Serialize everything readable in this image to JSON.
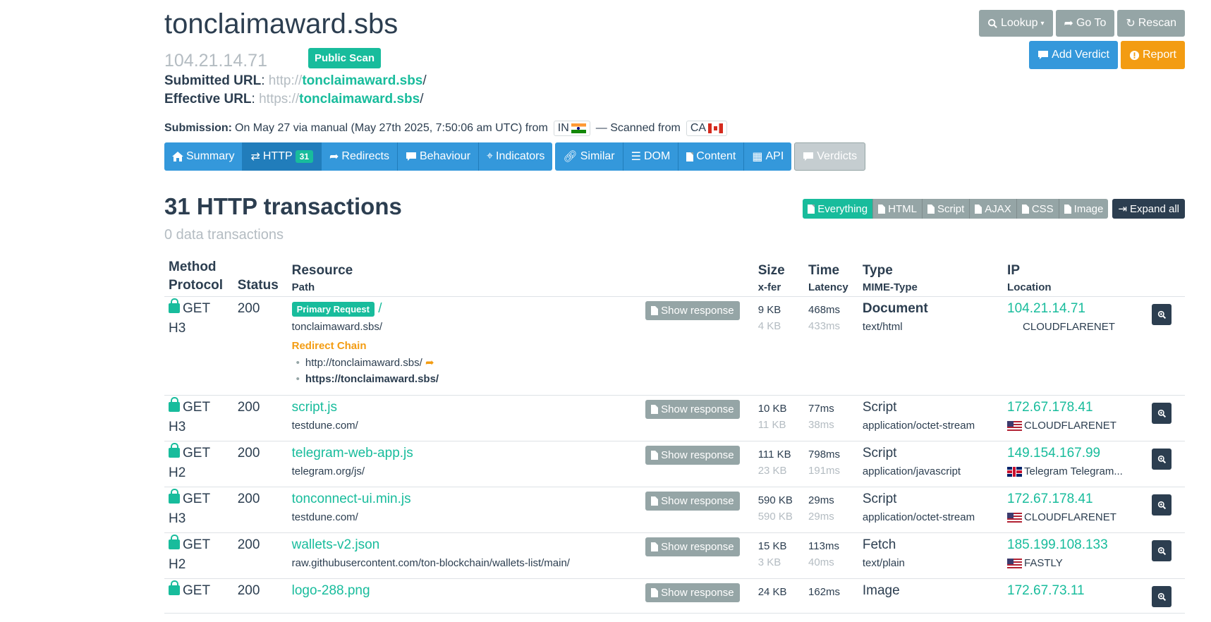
{
  "header": {
    "title": "tonclaimaward.sbs",
    "ip": "104.21.14.71",
    "public_badge": "Public Scan",
    "submitted_label": "Submitted URL",
    "submitted_proto": "http://",
    "submitted_host": "tonclaimaward.sbs",
    "submitted_path": "/",
    "effective_label": "Effective URL",
    "effective_proto": "https://",
    "effective_host": "tonclaimaward.sbs",
    "effective_path": "/",
    "submission_label": "Submission:",
    "submission_text": "On May 27 via manual (May 27th 2025, 7:50:06 am UTC) from",
    "from_country": "IN",
    "scanned_text": "— Scanned from",
    "scanned_country": "CA"
  },
  "actions": {
    "lookup": "Lookup",
    "goto": "Go To",
    "rescan": "Rescan",
    "add_verdict": "Add Verdict",
    "report": "Report"
  },
  "tabs": [
    {
      "label": "Summary"
    },
    {
      "label": "HTTP",
      "count": "31"
    },
    {
      "label": "Redirects"
    },
    {
      "label": "Behaviour"
    },
    {
      "label": "Indicators"
    },
    {
      "label": "Similar"
    },
    {
      "label": "DOM"
    },
    {
      "label": "Content"
    },
    {
      "label": "API"
    },
    {
      "label": "Verdicts"
    }
  ],
  "section": {
    "title": "31 HTTP transactions",
    "subtitle": "0 data transactions"
  },
  "filters": [
    "Everything",
    "HTML",
    "Script",
    "AJAX",
    "CSS",
    "Image"
  ],
  "expand_all": "Expand all",
  "table": {
    "headers": {
      "method": "Method",
      "protocol": "Protocol",
      "status": "Status",
      "resource": "Resource",
      "path": "Path",
      "size": "Size",
      "xfer": "x-fer",
      "time": "Time",
      "latency": "Latency",
      "type": "Type",
      "mime": "MIME-Type",
      "ip": "IP",
      "location": "Location"
    },
    "show_response": "Show response",
    "rows": [
      {
        "method": "GET",
        "protocol": "H3",
        "status": "200",
        "primary_badge": "Primary Request",
        "resource": "/",
        "path": "tonclaimaward.sbs/",
        "redirect_title": "Redirect Chain",
        "redirects": [
          "http://tonclaimaward.sbs/",
          "https://tonclaimaward.sbs/"
        ],
        "size": "9 KB",
        "xfer": "4 KB",
        "time": "468ms",
        "latency": "433ms",
        "type": "Document",
        "mime": "text/html",
        "ip": "104.21.14.71",
        "location": "CLOUDFLARENET",
        "flag": "none"
      },
      {
        "method": "GET",
        "protocol": "H3",
        "status": "200",
        "resource": "script.js",
        "path": "testdune.com/",
        "size": "10 KB",
        "xfer": "11 KB",
        "time": "77ms",
        "latency": "38ms",
        "type": "Script",
        "mime": "application/octet-stream",
        "ip": "172.67.178.41",
        "location": "CLOUDFLARENET",
        "flag": "us"
      },
      {
        "method": "GET",
        "protocol": "H2",
        "status": "200",
        "resource": "telegram-web-app.js",
        "path": "telegram.org/js/",
        "size": "111 KB",
        "xfer": "23 KB",
        "time": "798ms",
        "latency": "191ms",
        "type": "Script",
        "mime": "application/javascript",
        "ip": "149.154.167.99",
        "location": "Telegram Telegram...",
        "flag": "gb"
      },
      {
        "method": "GET",
        "protocol": "H3",
        "status": "200",
        "resource": "tonconnect-ui.min.js",
        "path": "testdune.com/",
        "size": "590 KB",
        "xfer": "590 KB",
        "time": "29ms",
        "latency": "29ms",
        "type": "Script",
        "mime": "application/octet-stream",
        "ip": "172.67.178.41",
        "location": "CLOUDFLARENET",
        "flag": "us"
      },
      {
        "method": "GET",
        "protocol": "H2",
        "status": "200",
        "resource": "wallets-v2.json",
        "path": "raw.githubusercontent.com/ton-blockchain/wallets-list/main/",
        "size": "15 KB",
        "xfer": "3 KB",
        "time": "113ms",
        "latency": "40ms",
        "type": "Fetch",
        "mime": "text/plain",
        "ip": "185.199.108.133",
        "location": "FASTLY",
        "flag": "us"
      },
      {
        "method": "GET",
        "protocol": "",
        "status": "200",
        "resource": "logo-288.png",
        "path": "",
        "size": "24 KB",
        "xfer": "",
        "time": "162ms",
        "latency": "",
        "type": "Image",
        "mime": "",
        "ip": "172.67.73.11",
        "location": "",
        "flag": "none"
      }
    ]
  }
}
